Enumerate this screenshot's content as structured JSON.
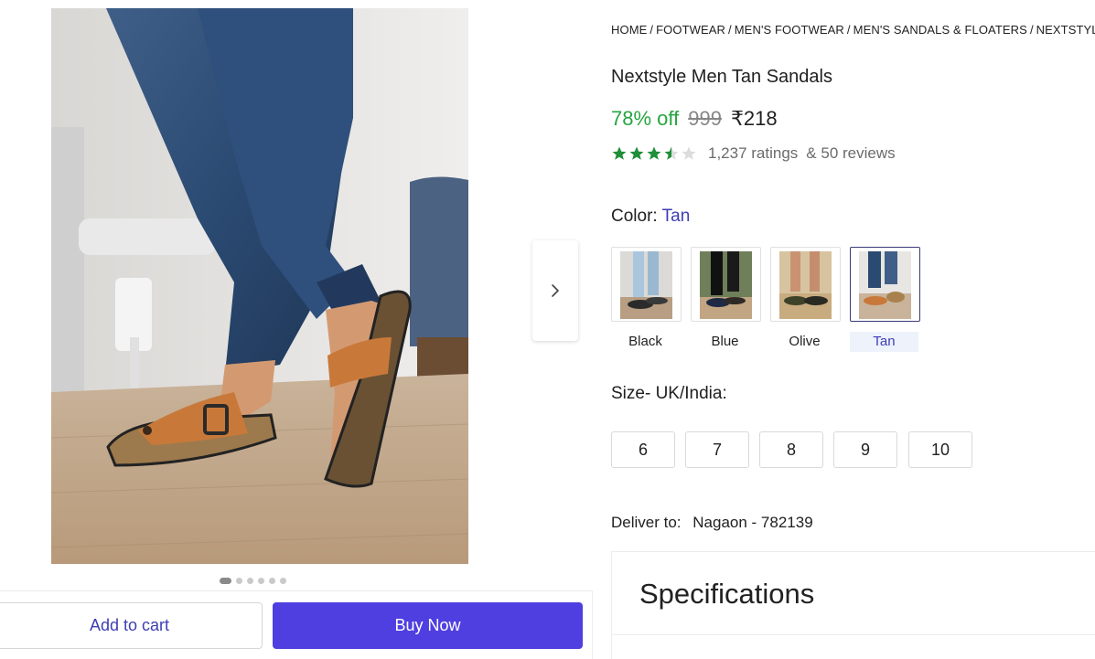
{
  "breadcrumb": [
    "HOME",
    "FOOTWEAR",
    "MEN'S FOOTWEAR",
    "MEN'S SANDALS & FLOATERS",
    "NEXTSTYLE MEN'S SANDALS"
  ],
  "product": {
    "title": "Nextstyle Men Tan Sandals",
    "discount": "78% off",
    "mrp": "999",
    "price": "₹218",
    "rating_value": 3.5,
    "ratings": "1,237 ratings",
    "reviews": "& 50 reviews"
  },
  "gallery": {
    "image_count": 6,
    "active_index": 0,
    "next_icon": "chevron-right-icon"
  },
  "color": {
    "label": "Color:",
    "selected": "Tan",
    "options": [
      {
        "label": "Black",
        "strap": "#2b2b2b",
        "sole": "#3a3a3a"
      },
      {
        "label": "Blue",
        "strap": "#1e2a44",
        "sole": "#2e2a25"
      },
      {
        "label": "Olive",
        "strap": "#3d4228",
        "sole": "#2a2a22"
      },
      {
        "label": "Tan",
        "strap": "#c8793a",
        "sole": "#a8814e"
      }
    ]
  },
  "size": {
    "label": "Size- UK/India:",
    "options": [
      "6",
      "7",
      "8",
      "9",
      "10"
    ]
  },
  "delivery": {
    "label": "Deliver to:",
    "location": "Nagaon - 782139"
  },
  "specifications": {
    "title": "Specifications"
  },
  "actions": {
    "add_to_cart": "Add to cart",
    "buy_now": "Buy Now"
  },
  "colors": {
    "accent": "#4f3fe0",
    "link": "#3d3db5",
    "discount": "#26a541",
    "star": "#1f8f3a"
  }
}
